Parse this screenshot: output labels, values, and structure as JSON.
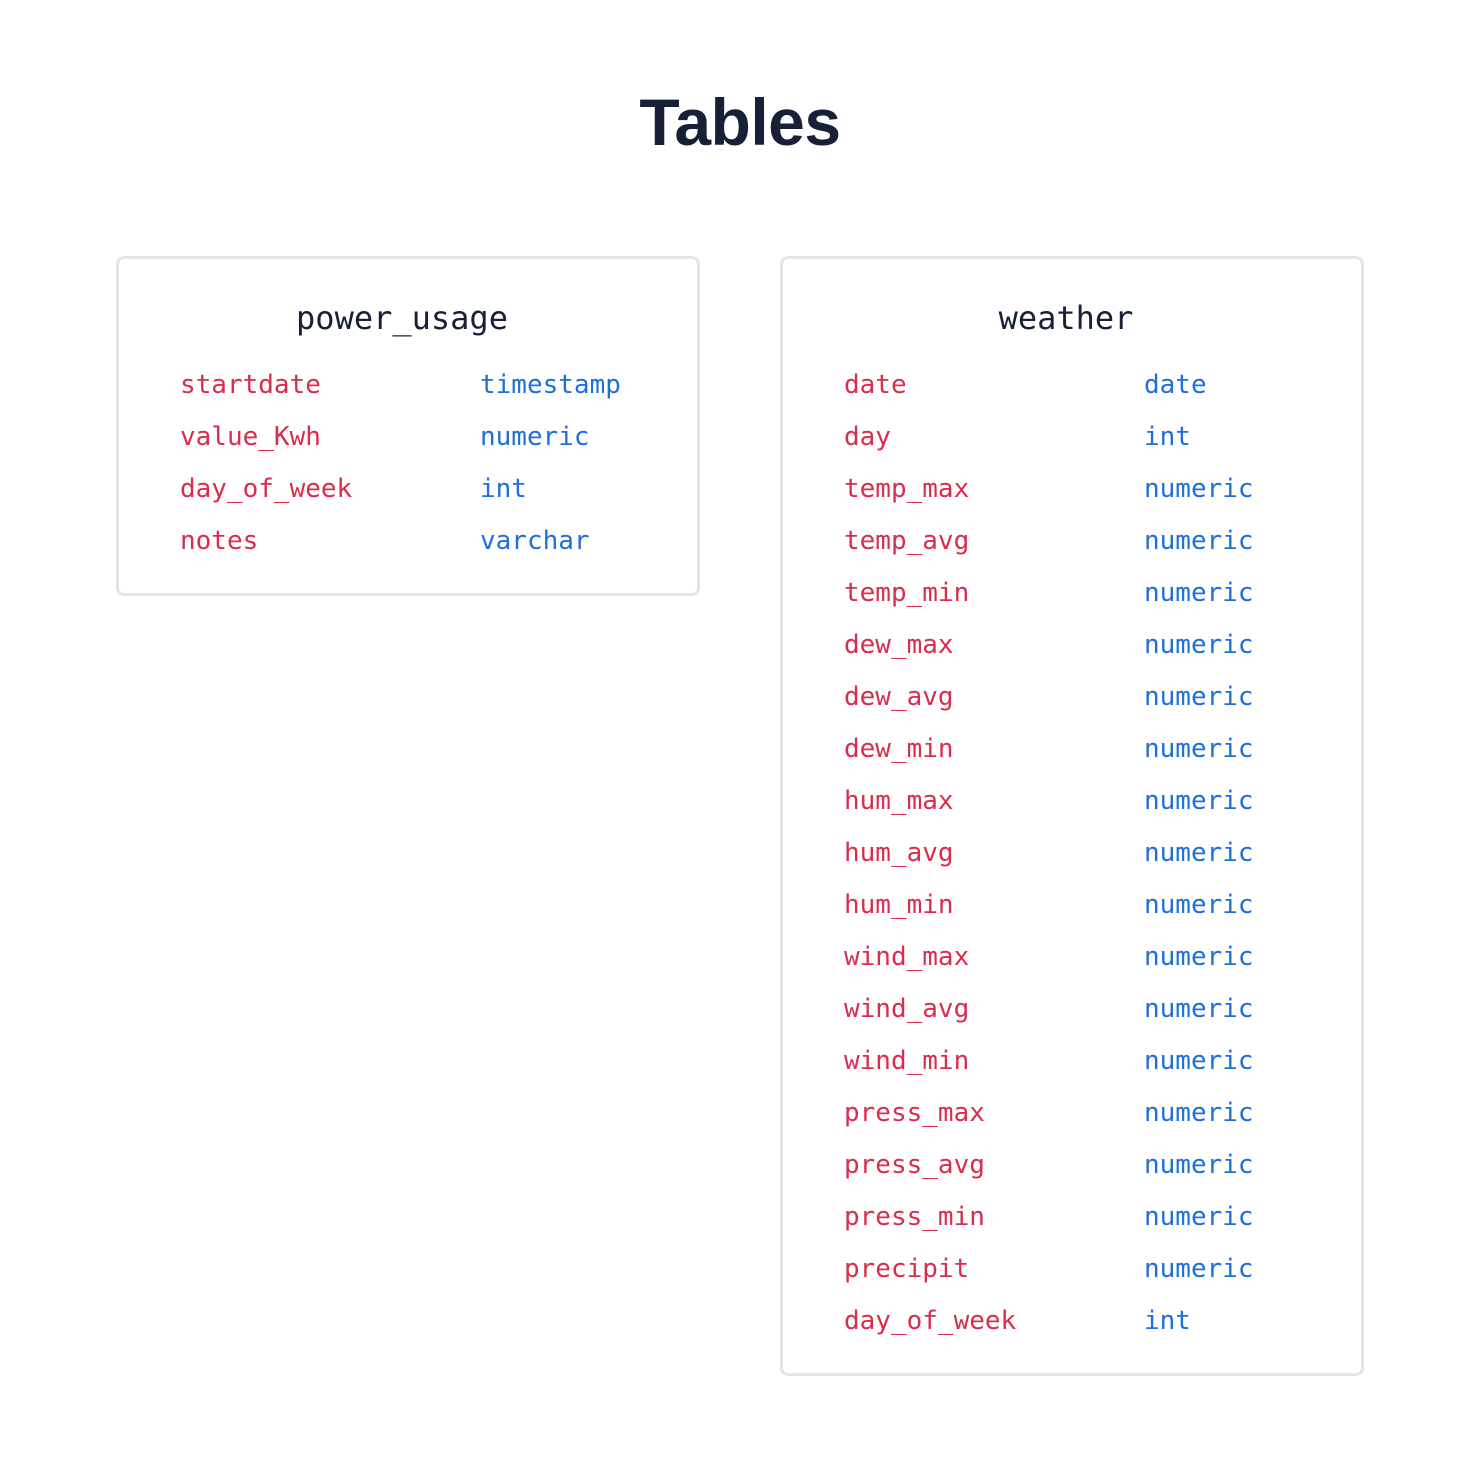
{
  "page": {
    "title": "Tables"
  },
  "colors": {
    "title": "#172036",
    "field_name": "#d92d4d",
    "field_type": "#1e6fd9",
    "card_border": "#e4e5ea"
  },
  "tables": [
    {
      "name": "power_usage",
      "columns": [
        {
          "name": "startdate",
          "type": "timestamp"
        },
        {
          "name": "value_Kwh",
          "type": "numeric"
        },
        {
          "name": "day_of_week",
          "type": "int"
        },
        {
          "name": "notes",
          "type": "varchar"
        }
      ]
    },
    {
      "name": "weather",
      "columns": [
        {
          "name": "date",
          "type": "date"
        },
        {
          "name": "day",
          "type": "int"
        },
        {
          "name": "temp_max",
          "type": "numeric"
        },
        {
          "name": "temp_avg",
          "type": "numeric"
        },
        {
          "name": "temp_min",
          "type": "numeric"
        },
        {
          "name": "dew_max",
          "type": "numeric"
        },
        {
          "name": "dew_avg",
          "type": "numeric"
        },
        {
          "name": "dew_min",
          "type": "numeric"
        },
        {
          "name": "hum_max",
          "type": "numeric"
        },
        {
          "name": "hum_avg",
          "type": "numeric"
        },
        {
          "name": "hum_min",
          "type": "numeric"
        },
        {
          "name": "wind_max",
          "type": "numeric"
        },
        {
          "name": "wind_avg",
          "type": "numeric"
        },
        {
          "name": "wind_min",
          "type": "numeric"
        },
        {
          "name": "press_max",
          "type": "numeric"
        },
        {
          "name": "press_avg",
          "type": "numeric"
        },
        {
          "name": "press_min",
          "type": "numeric"
        },
        {
          "name": "precipit",
          "type": "numeric"
        },
        {
          "name": "day_of_week",
          "type": "int"
        }
      ]
    }
  ]
}
